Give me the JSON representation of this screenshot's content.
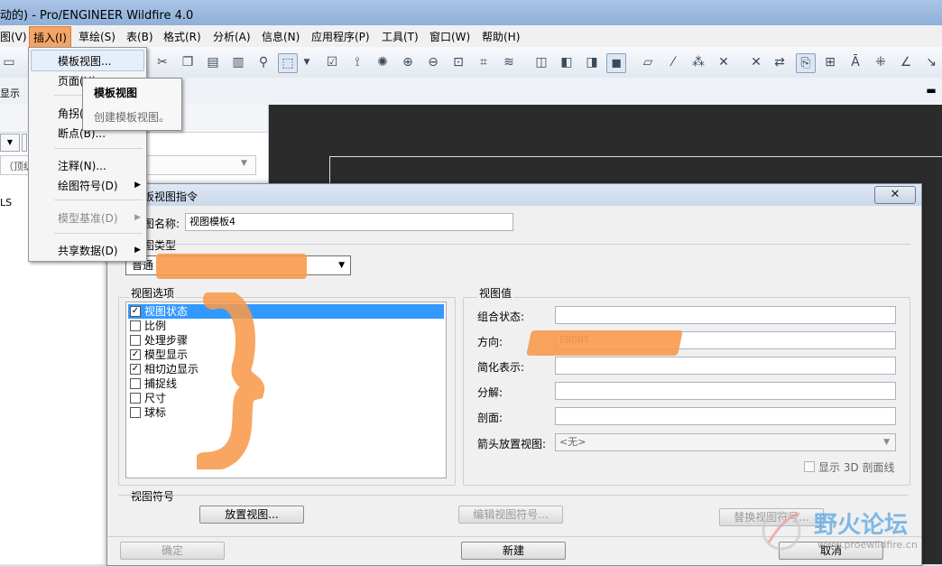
{
  "window": {
    "title": "动的) - Pro/ENGINEER Wildfire 4.0"
  },
  "menubar": {
    "items": [
      "图(V)",
      "插入(I)",
      "草绘(S)",
      "表(B)",
      "格式(R)",
      "分析(A)",
      "信息(N)",
      "应用程序(P)",
      "工具(T)",
      "窗口(W)",
      "帮助(H)"
    ]
  },
  "subbar": {
    "label": "显示"
  },
  "left_panel": {
    "path_text": "（顶级",
    "item": "LS"
  },
  "insert_menu": {
    "items": [
      {
        "label": "模板视图...",
        "disabled": false,
        "submenu": false
      },
      {
        "label": "页面(H)",
        "disabled": false,
        "submenu": false
      },
      {
        "label": "角拐(",
        "disabled": false,
        "submenu": false
      },
      {
        "label": "断点(B)...",
        "disabled": false,
        "submenu": false
      },
      {
        "label": "注释(N)...",
        "disabled": false,
        "submenu": false
      },
      {
        "label": "绘图符号(D)",
        "disabled": false,
        "submenu": true
      },
      {
        "label": "模型基准(D)",
        "disabled": true,
        "submenu": true
      },
      {
        "label": "共享数据(D)",
        "disabled": false,
        "submenu": true
      }
    ]
  },
  "tooltip": {
    "title": "模板视图",
    "description": "创建模板视图。"
  },
  "dialog": {
    "title": "板视图指令",
    "close_symbol": "✕",
    "name_label": "图名称:",
    "name_value": "视图模板4",
    "type_label": "图类型",
    "type_value": "普通",
    "view_options": {
      "label": "视图选项",
      "items": [
        {
          "label": "视图状态",
          "checked": true,
          "selected": true
        },
        {
          "label": "比例",
          "checked": false,
          "selected": false
        },
        {
          "label": "处理步骤",
          "checked": false,
          "selected": false
        },
        {
          "label": "模型显示",
          "checked": true,
          "selected": false
        },
        {
          "label": "相切边显示",
          "checked": true,
          "selected": false
        },
        {
          "label": "捕捉线",
          "checked": false,
          "selected": false
        },
        {
          "label": "尺寸",
          "checked": false,
          "selected": false
        },
        {
          "label": "球标",
          "checked": false,
          "selected": false
        }
      ]
    },
    "view_values": {
      "label": "视图值",
      "fields": [
        {
          "label": "组合状态:",
          "value": ""
        },
        {
          "label": "方向:",
          "value": "FRONT"
        },
        {
          "label": "简化表示:",
          "value": ""
        },
        {
          "label": "分解:",
          "value": ""
        },
        {
          "label": "剖面:",
          "value": ""
        }
      ],
      "arrow_label": "箭头放置视图:",
      "arrow_value": "<无>",
      "show_3d_label": "显示 3D 剖面线"
    },
    "view_symbol": {
      "label": "视图符号",
      "place_button": "放置视图...",
      "edit_button": "编辑视图符号...",
      "replace_button": "替换视图符号..."
    },
    "buttons": {
      "ok": "确定",
      "new": "新建",
      "cancel": "取消"
    }
  },
  "watermark": {
    "text": "野火论坛",
    "url": "www.proewildfire.cn"
  },
  "colors": {
    "highlight": "#3399ff",
    "annotation": "#f79a4c"
  }
}
